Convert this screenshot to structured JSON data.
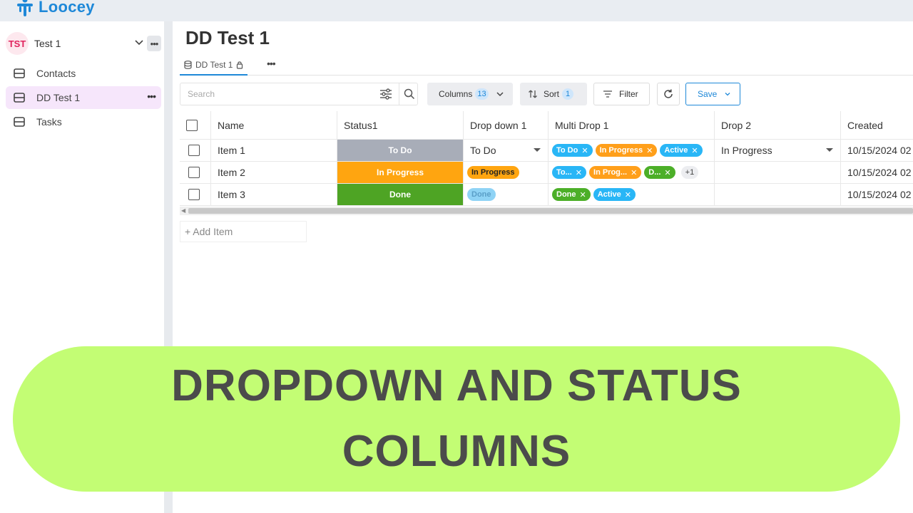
{
  "app": {
    "logo_text": "Loocey",
    "brand_color": "#1e88d8"
  },
  "sidebar": {
    "workspace": {
      "badge": "TST",
      "name": "Test 1"
    },
    "items": [
      {
        "label": "Contacts",
        "active": false
      },
      {
        "label": "DD Test 1",
        "active": true
      },
      {
        "label": "Tasks",
        "active": false
      }
    ]
  },
  "main": {
    "title": "DD Test 1",
    "tab": {
      "label": "DD Test 1",
      "icon": "database-icon",
      "lock_icon": "lock-icon"
    }
  },
  "toolbar": {
    "search_placeholder": "Search",
    "columns_label": "Columns",
    "columns_count": "13",
    "sort_label": "Sort",
    "sort_count": "1",
    "filter_label": "Filter",
    "refresh_icon": "refresh-icon",
    "save_label": "Save"
  },
  "table": {
    "headers": [
      "Name",
      "Status1",
      "Drop down 1",
      "Multi Drop 1",
      "Drop 2",
      "Created"
    ],
    "rows": [
      {
        "name": "Item 1",
        "status": {
          "label": "To Do",
          "color": "#a8adb8"
        },
        "dropdown1": {
          "value": "To Do",
          "type": "select"
        },
        "multi": [
          {
            "label": "To Do",
            "color": "blue"
          },
          {
            "label": "In Progress",
            "color": "orange"
          },
          {
            "label": "Active",
            "color": "blue"
          }
        ],
        "multi_more": "",
        "drop2": "In Progress",
        "created": "10/15/2024 02"
      },
      {
        "name": "Item 2",
        "status": {
          "label": "In Progress",
          "color": "#ffa510"
        },
        "dropdown1": {
          "value": "In Progress",
          "type": "pill",
          "color": "#ffa510",
          "text_color": "#222"
        },
        "multi": [
          {
            "label": "To...",
            "color": "blue"
          },
          {
            "label": "In Prog...",
            "color": "orange"
          },
          {
            "label": "D...",
            "color": "green"
          }
        ],
        "multi_more": "+1",
        "drop2": "",
        "created": "10/15/2024 02"
      },
      {
        "name": "Item 3",
        "status": {
          "label": "Done",
          "color": "#4ea424"
        },
        "dropdown1": {
          "value": "Done",
          "type": "pill",
          "color": "#8fd3f5",
          "text_color": "#5a9fc8"
        },
        "multi": [
          {
            "label": "Done",
            "color": "green"
          },
          {
            "label": "Active",
            "color": "blue"
          }
        ],
        "multi_more": "",
        "drop2": "",
        "created": "10/15/2024 02"
      }
    ],
    "add_item_label": "+ Add Item"
  },
  "banner": {
    "line1": "DROPDOWN AND STATUS",
    "line2": "COLUMNS",
    "background": "#c3fd74"
  }
}
